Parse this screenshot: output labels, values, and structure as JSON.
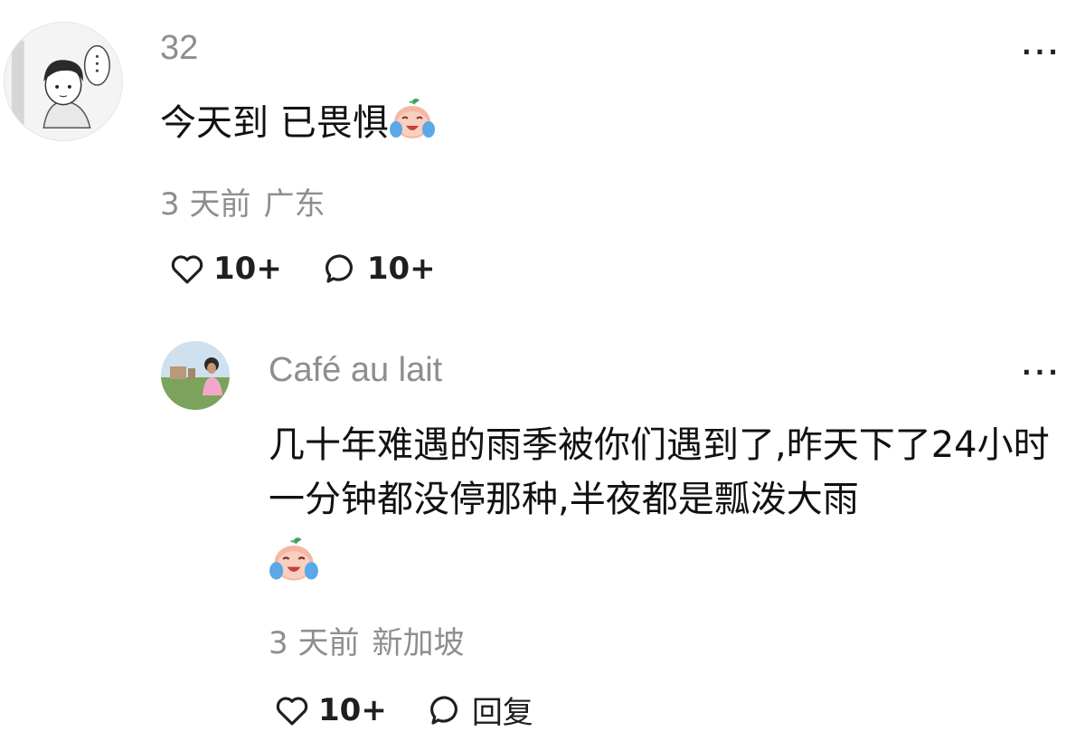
{
  "comment": {
    "username": "32",
    "text": "今天到 已畏惧",
    "time": "3 天前",
    "location": "广东",
    "like_count": "10+",
    "reply_count": "10+",
    "more_glyph": "···"
  },
  "reply": {
    "username": "Café au lait",
    "text": "几十年难遇的雨季被你们遇到了,昨天下了24小时一分钟都没停那种,半夜都是瓢泼大雨",
    "time": "3 天前",
    "location": "新加坡",
    "like_count": "10+",
    "reply_label": "回复",
    "more_glyph": "···"
  },
  "icons": {
    "like": "heart-outline-icon",
    "comment": "speech-bubble-icon",
    "more": "more-dots-icon",
    "emoji": "crying-face-emoji"
  }
}
